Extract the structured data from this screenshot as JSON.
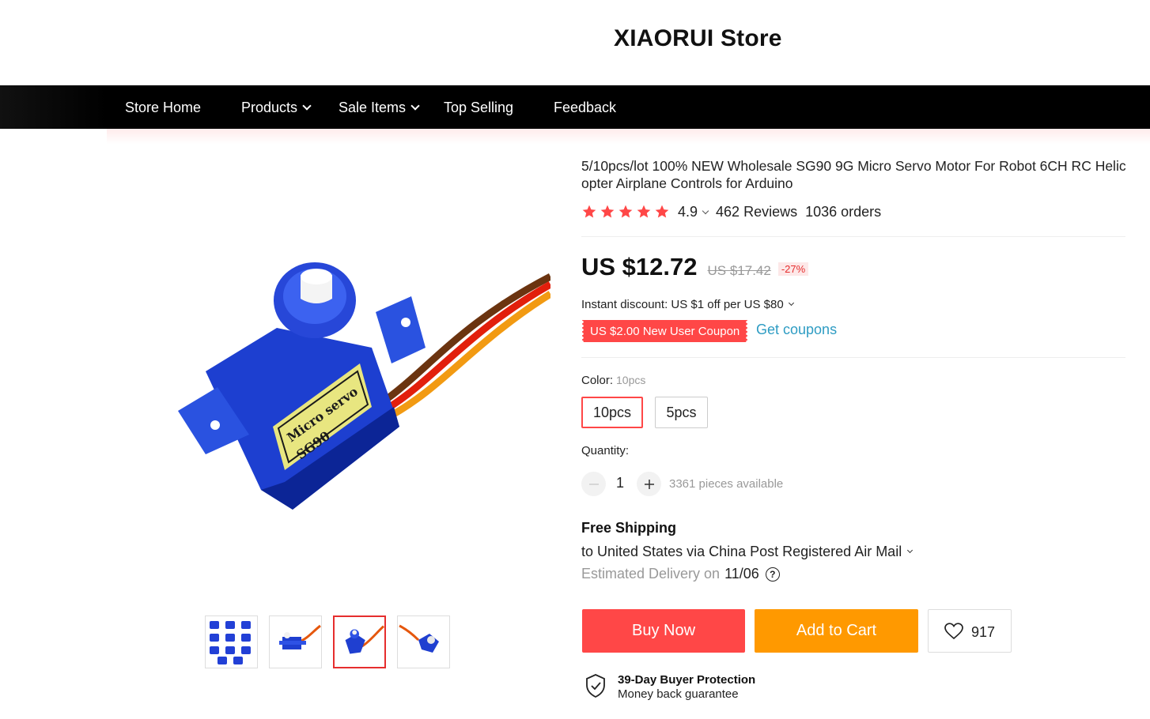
{
  "store": {
    "name": "XIAORUI Store"
  },
  "nav": {
    "items": [
      {
        "label": "Store Home",
        "has_dropdown": false
      },
      {
        "label": "Products",
        "has_dropdown": true
      },
      {
        "label": "Sale Items",
        "has_dropdown": true
      },
      {
        "label": "Top Selling",
        "has_dropdown": false
      },
      {
        "label": "Feedback",
        "has_dropdown": false
      }
    ]
  },
  "gallery": {
    "main_image_icon": "servo-motor-image",
    "thumbnails": [
      {
        "icon": "servo-pack-thumbnail",
        "active": false
      },
      {
        "icon": "servo-side-thumbnail",
        "active": false
      },
      {
        "icon": "servo-front-thumbnail",
        "active": true
      },
      {
        "icon": "servo-angle-thumbnail",
        "active": false
      }
    ]
  },
  "product": {
    "title": "5/10pcs/lot 100% NEW Wholesale SG90 9G Micro Servo Motor For Robot 6CH RC Helicopter Airplane Controls for Arduino",
    "rating": "4.9",
    "stars": 5,
    "reviews": "462 Reviews",
    "orders": "1036 orders",
    "price": "US $12.72",
    "old_price": "US $17.42",
    "discount": "-27%",
    "instant_discount": "Instant discount: US $1 off per US $80",
    "coupon": "US $2.00 New User Coupon",
    "get_coupons": "Get coupons",
    "color_label": "Color:",
    "color_selected": "10pcs",
    "color_options": [
      "10pcs",
      "5pcs"
    ],
    "quantity_label": "Quantity:",
    "quantity": "1",
    "available": "3361 pieces available",
    "shipping_title": "Free Shipping",
    "shipping_to": "to United States via China Post Registered Air Mail",
    "delivery_label": "Estimated Delivery on",
    "delivery_date": "11/06",
    "buy_now": "Buy Now",
    "add_to_cart": "Add to Cart",
    "wishlist_count": "917",
    "protection_title": "39-Day Buyer Protection",
    "protection_sub": "Money back guarantee"
  },
  "colors": {
    "accent": "#ff4747",
    "cart": "#ff9900",
    "link": "#2e9cc3",
    "star": "#ff4747",
    "nav_bg": "#000000"
  }
}
